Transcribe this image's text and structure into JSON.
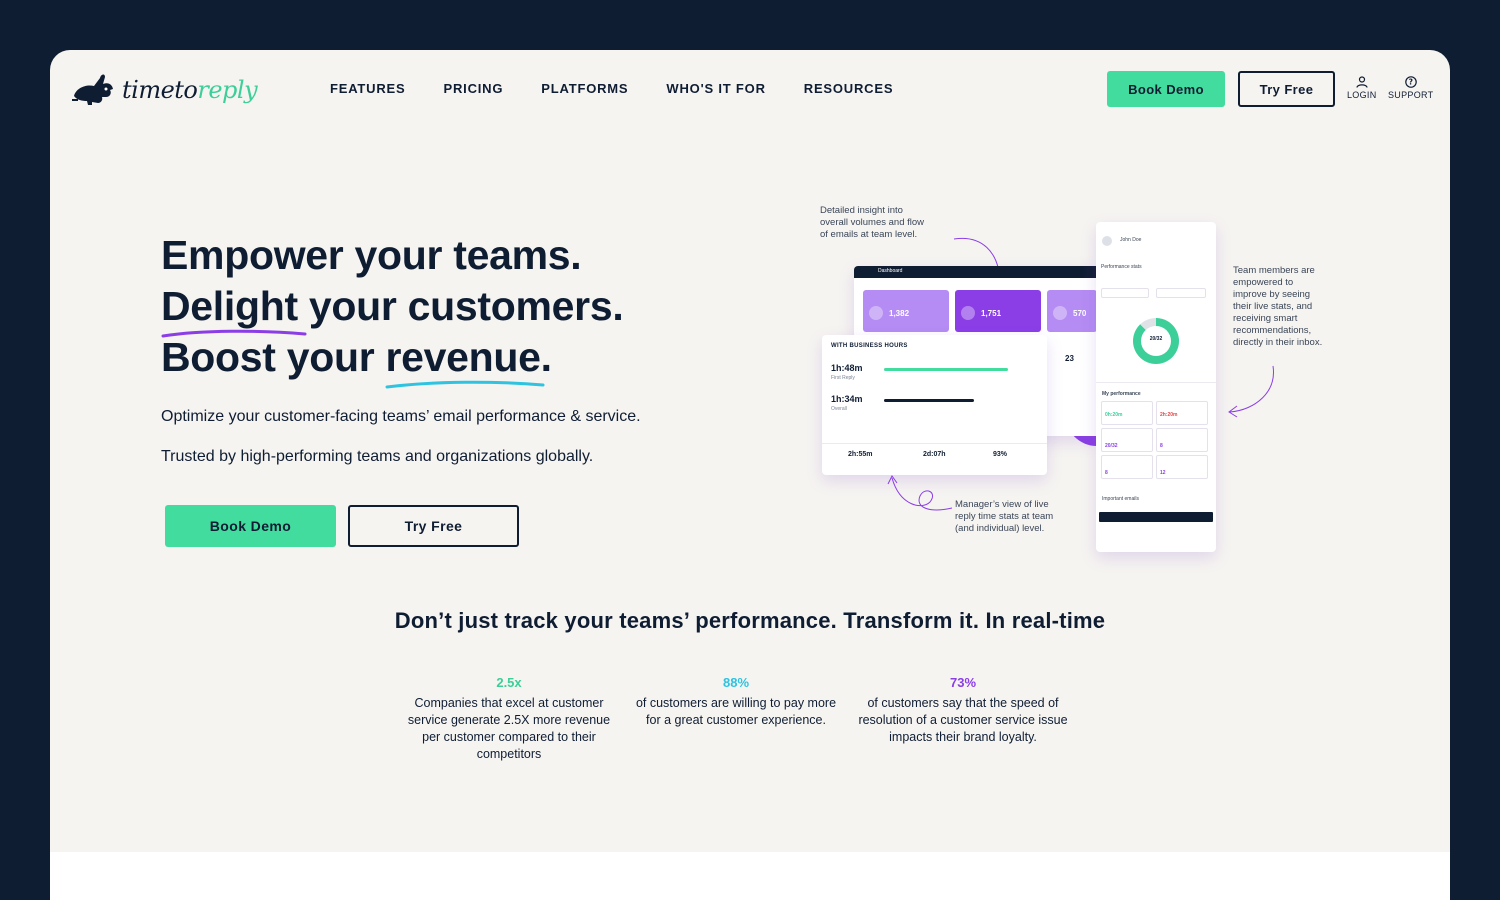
{
  "brand": {
    "name_prefix": "timeto",
    "name_accent": "reply",
    "accent_color": "#43dc9f",
    "dark_color": "#0f1d33"
  },
  "nav": {
    "items": [
      "FEATURES",
      "PRICING",
      "PLATFORMS",
      "WHO'S IT FOR",
      "RESOURCES"
    ]
  },
  "header": {
    "book_demo": "Book Demo",
    "try_free": "Try Free",
    "login": "LOGIN",
    "support": "SUPPORT"
  },
  "hero": {
    "line1": "Empower your teams.",
    "line2_a": "Delight",
    "line2_b": " your customers.",
    "line3_a": "Boost your ",
    "line3_b": "revenue",
    "line3_c": ".",
    "sub1": "Optimize your customer-facing teams’ email performance & service.",
    "sub2": "Trusted by high-performing teams and organizations globally.",
    "book_demo": "Book Demo",
    "try_free": "Try Free"
  },
  "illustration": {
    "annotation_top": [
      "Detailed insight into",
      "overall volumes and flow",
      "of emails at team level."
    ],
    "annotation_right": [
      "Team members are",
      "empowered to",
      "improve by seeing",
      "their live stats, and",
      "receiving smart",
      "recommendations,",
      "directly in their inbox."
    ],
    "annotation_bottom": [
      "Manager’s view of live",
      "reply time stats at team",
      "(and individual) level."
    ],
    "dashboard": {
      "title": "Dashboard",
      "tiles": [
        "1,382",
        "1,751",
        "570"
      ],
      "side_value": "23"
    },
    "business_hours": {
      "title": "WITH BUSINESS HOURS",
      "first_reply_value": "1h:48m",
      "first_reply_label": "First Reply",
      "overall_value": "1h:34m",
      "overall_label": "Overall",
      "stats": [
        "2h:55m",
        "2d:07h",
        "93%"
      ]
    },
    "phone": {
      "user": "John Doe",
      "section": "Performance stats",
      "donut_label": "20/32",
      "my_performance": "My performance",
      "kpis": [
        "0h:20m",
        "2h:20m",
        "20/32",
        "8",
        "8",
        "12"
      ],
      "important": "Important emails"
    }
  },
  "stats_section": {
    "heading": "Don’t just track your teams’ performance. Transform it. In real-time",
    "items": [
      {
        "value": "2.5x",
        "color": "#3ccf9a",
        "text": "Companies that excel at customer service generate 2.5X more revenue per customer compared to their competitors"
      },
      {
        "value": "88%",
        "color": "#2ec3e0",
        "text": "of customers are willing to pay more for a great customer experience."
      },
      {
        "value": "73%",
        "color": "#8b3ee6",
        "text": "of customers say that the speed of resolution of a customer service issue impacts their brand loyalty."
      }
    ]
  }
}
